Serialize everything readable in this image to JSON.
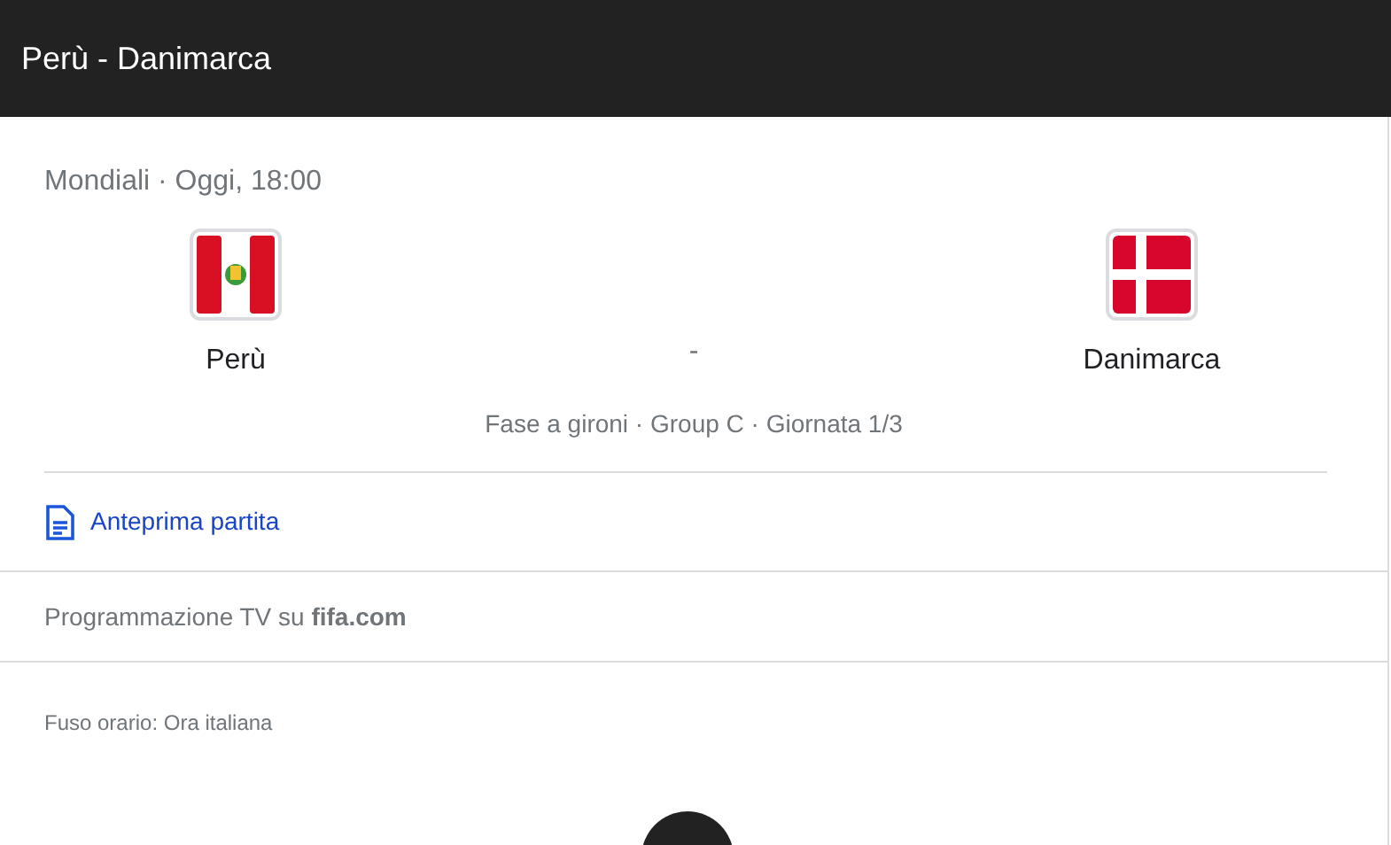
{
  "header": {
    "title": "Perù - Danimarca"
  },
  "match": {
    "competition": "Mondiali · Oggi, 18:00",
    "teams": [
      {
        "name": "Perù"
      },
      {
        "name": "Danimarca"
      }
    ],
    "score": "-",
    "stage": "Fase a gironi · Group C · Giornata 1/3"
  },
  "preview_link": "Anteprima partita",
  "tv_schedule": "Programmazione TV su **fifa.com**",
  "timezone": "Fuso orario: Ora italiana"
}
